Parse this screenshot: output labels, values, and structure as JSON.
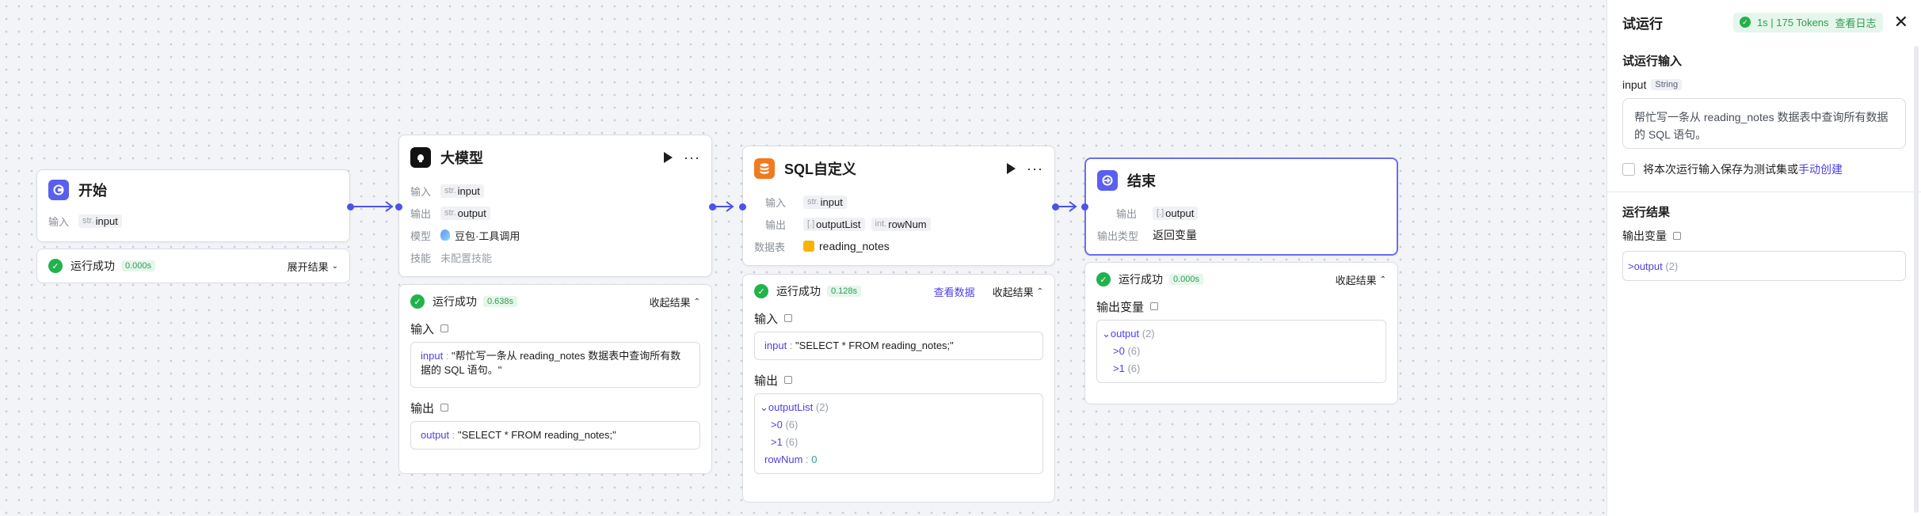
{
  "nodes": {
    "start": {
      "title": "开始",
      "input_label": "输入",
      "input_type": "str.",
      "input_name": "input",
      "status": "运行成功",
      "time": "0.000s",
      "action": "展开结果"
    },
    "llm": {
      "title": "大模型",
      "input_label": "输入",
      "input_type": "str.",
      "input_name": "input",
      "output_label": "输出",
      "output_type": "str.",
      "output_name": "output",
      "model_label": "模型",
      "model_value": "豆包·工具调用",
      "skill_label": "技能",
      "skill_value": "未配置技能",
      "status": "运行成功",
      "time": "0.638s",
      "action": "收起结果",
      "in_section": "输入",
      "in_key": "input",
      "in_value": "\"帮忙写一条从 reading_notes 数据表中查询所有数据的 SQL 语句。\"",
      "out_section": "输出",
      "out_key": "output",
      "out_value": "\"SELECT * FROM reading_notes;\""
    },
    "sql": {
      "title": "SQL自定义",
      "input_label": "输入",
      "input_type": "str.",
      "input_name": "input",
      "output_label": "输出",
      "output1_type": "[.]",
      "output1_name": "outputList",
      "output2_type": "int.",
      "output2_name": "rowNum",
      "db_label": "数据表",
      "db_value": "reading_notes",
      "status": "运行成功",
      "time": "0.128s",
      "view_link": "查看数据",
      "action": "收起结果",
      "in_section": "输入",
      "in_key": "input",
      "in_value": "\"SELECT * FROM reading_notes;\"",
      "out_section": "输出",
      "out_list_key": "outputList",
      "out_list_count": "(2)",
      "out_item0": "0",
      "out_item0_count": "(6)",
      "out_item1": "1",
      "out_item1_count": "(6)",
      "rownum_key": "rowNum",
      "rownum_value": "0"
    },
    "end": {
      "title": "结束",
      "output_label": "输出",
      "output_type": "[.]",
      "output_name": "output",
      "out_type_label": "输出类型",
      "out_type_value": "返回变量",
      "status": "运行成功",
      "time": "0.000s",
      "action": "收起结果",
      "var_section": "输出变量",
      "out_key": "output",
      "out_count": "(2)",
      "item0": "0",
      "item0_count": "(6)",
      "item1": "1",
      "item1_count": "(6)"
    }
  },
  "panel": {
    "title": "试运行",
    "badge": "1s | 175 Tokens",
    "log_link": "查看日志",
    "input_section": "试运行输入",
    "input_name": "input",
    "input_type": "String",
    "input_value": "帮忙写一条从 reading_notes 数据表中查询所有数据的 SQL 语句。",
    "save_text": "将本次运行输入保存为测试集或",
    "save_link": "手动创建",
    "result_section": "运行结果",
    "output_var_label": "输出变量",
    "output_key": "output",
    "output_count": "(2)"
  },
  "colors": {
    "accent": "#4d53e8",
    "success": "#22b24c",
    "link": "#4e40e5",
    "start_icon": "#5a5ff0",
    "sql_icon": "#f07a1f",
    "end_icon": "#5a5ff0"
  },
  "icons": {
    "start": "start-icon",
    "llm": "llm-brain-icon",
    "sql": "database-icon",
    "end": "end-icon"
  }
}
